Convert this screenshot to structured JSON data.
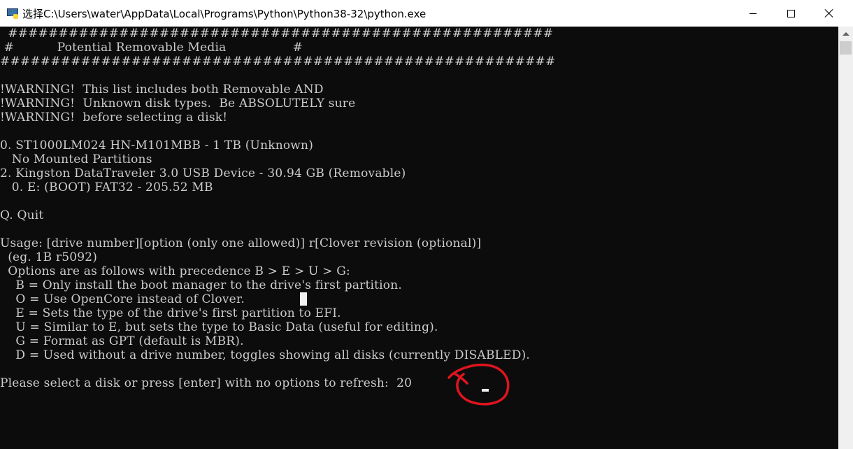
{
  "window": {
    "title": "选择C:\\Users\\water\\AppData\\Local\\Programs\\Python\\Python38-32\\python.exe",
    "app_icon": "python-console-icon",
    "controls": {
      "minimize": "minimize-icon",
      "maximize": "maximize-icon",
      "close": "close-icon"
    }
  },
  "console": {
    "lines": [
      "  ######################################################",
      " #           Potential Removable Media                 #",
      "#######################################################",
      "",
      "!WARNING!  This list includes both Removable AND",
      "!WARNING!  Unknown disk types.  Be ABSOLUTELY sure",
      "!WARNING!  before selecting a disk!",
      "",
      "0. ST1000LM024 HN-M101MBB - 1 TB (Unknown)",
      "   No Mounted Partitions",
      "2. Kingston DataTraveler 3.0 USB Device - 30.94 GB (Removable)",
      "   0. E: (BOOT) FAT32 - 205.52 MB",
      "",
      "Q. Quit",
      "",
      "Usage: [drive number][option (only one allowed)] r[Clover revision (optional)]",
      "  (eg. 1B r5092)",
      "  Options are as follows with precedence B > E > U > G:",
      "    B = Only install the boot manager to the drive's first partition.",
      "    O = Use OpenCore instead of Clover.",
      "    E = Sets the type of the drive's first partition to EFI.",
      "    U = Similar to E, but sets the type to Basic Data (useful for editing).",
      "    G = Format as GPT (default is MBR).",
      "    D = Used without a drive number, toggles showing all disks (currently DISABLED).",
      "",
      "Please select a disk or press [enter] with no options to refresh:  20"
    ]
  },
  "annotation": {
    "color": "#e0141e"
  },
  "colors": {
    "console_bg": "#0c0c0c",
    "console_fg": "#cccccc",
    "titlebar_bg": "#ffffff"
  }
}
